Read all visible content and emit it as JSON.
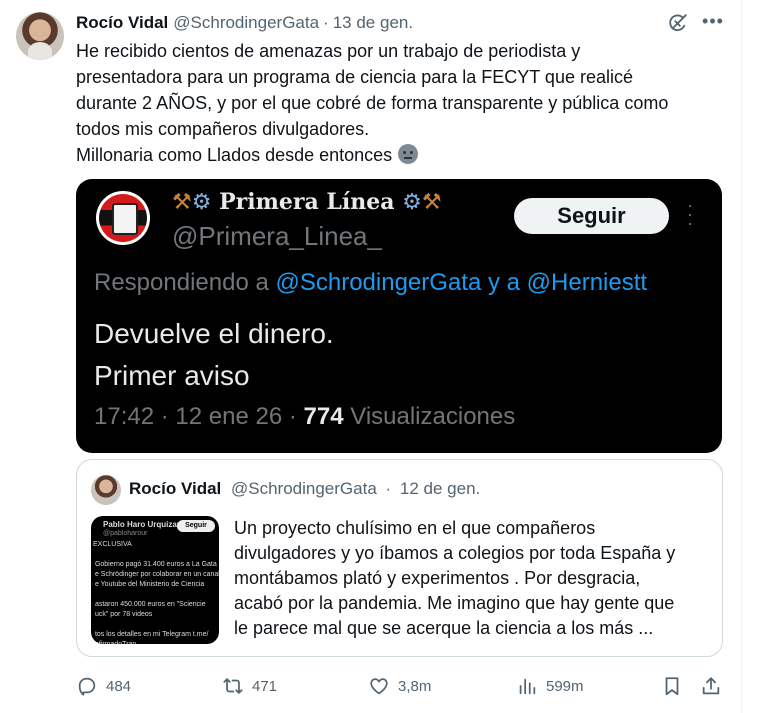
{
  "tweet": {
    "author_name": "Rocío Vidal",
    "author_handle": "@SchrodingerGata",
    "separator": "·",
    "date": "13 de gen.",
    "text_lines": [
      "He recibido cientos de amenazas por un trabajo de periodista y",
      "presentadora para un programa de ciencia para la FECYT que realicé",
      "durante 2 AÑOS, y por el que cobré de forma transparente y pública como",
      "todos mis compañeros divulgadores.",
      "Millonaria como Llados desde entonces"
    ],
    "emoji": "neutral-face-emoji"
  },
  "media": {
    "name_text": "Primera Línea",
    "name_left_icons": "⚒️⚙️",
    "name_right_icons": "⚙️⚒️",
    "handle": "@Primera_Linea_",
    "follow_label": "Seguir",
    "reply_prefix": "Respondiendo a",
    "reply_mention_1": "@SchrodingerGata",
    "reply_joiner": "y a",
    "reply_mention_2": "@Herniestt",
    "body_lines": [
      "Devuelve el dinero.",
      "Primer aviso"
    ],
    "time": "17:42",
    "date": "12 ene 26",
    "views_count": "774",
    "views_label": "Visualizaciones"
  },
  "quote": {
    "author_name": "Rocío Vidal",
    "author_handle": "@SchrodingerGata",
    "separator": "·",
    "date": "12 de gen.",
    "thumb": {
      "name": "Pablo Haro Urquizar",
      "handle": "@pabloharour",
      "follow": "Seguir",
      "lines": "EXCLUSIVA\n\n Gobierno pagó 31.400 euros a La Gata\n e Schrödinger por colaborar en un canal\n e Youtube del Ministerio de Ciencia\n\n astaron 450.000 euros en \"Sciencie\n uck\" por 78 videos\n\n tos los detalles en mi Telegram t.me/\n nfirmadoTran..."
    },
    "text_lines": [
      "Un proyecto chulísimo en el que compañeros",
      "divulgadores y yo íbamos a colegios por toda España y",
      "montábamos plató y experimentos . Por desgracia,",
      "acabó por la pandemia. Me imagino que hay gente que",
      "le parece mal que se acerque la ciencia a los más ..."
    ]
  },
  "actions": {
    "replies": "484",
    "reposts": "471",
    "likes": "3,8m",
    "views": "599m"
  },
  "colors": {
    "text": "#0f1419",
    "secondary": "#536471",
    "link": "#1d9bf0",
    "border": "#cfd9de"
  }
}
